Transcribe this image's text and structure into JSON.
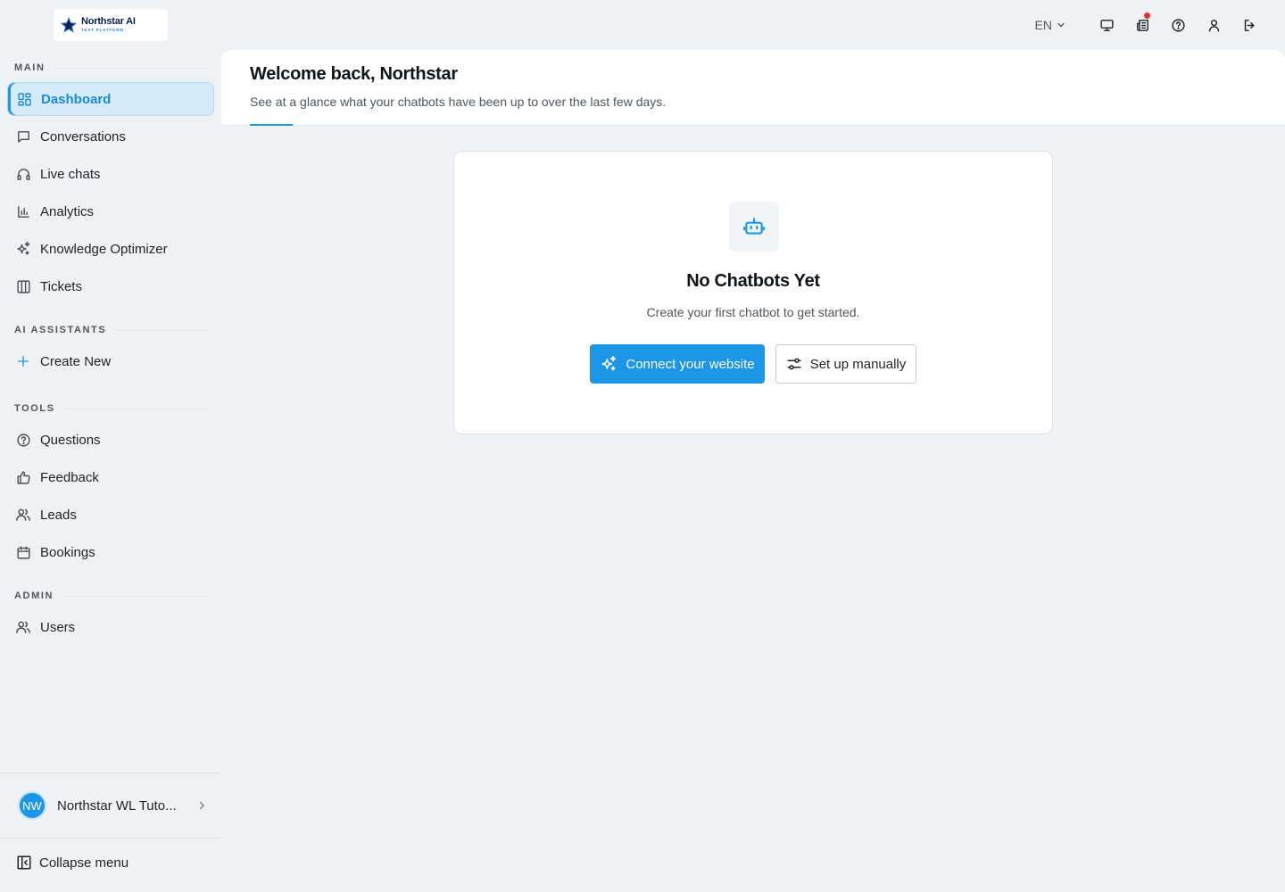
{
  "logo": {
    "name": "Northstar AI",
    "tagline": "TEST PLATFORM"
  },
  "topbar": {
    "language": "EN",
    "icons": [
      "monitor-icon",
      "news-icon",
      "help-icon",
      "user-icon",
      "logout-icon"
    ],
    "notification_color": "#e5302f"
  },
  "sidebar": {
    "sections": {
      "main": "MAIN",
      "ai_assistants": "AI ASSISTANTS",
      "tools": "TOOLS",
      "admin": "ADMIN"
    },
    "main_items": [
      {
        "label": "Dashboard",
        "icon": "dashboard-icon",
        "active": true
      },
      {
        "label": "Conversations",
        "icon": "chat-icon"
      },
      {
        "label": "Live chats",
        "icon": "headset-icon"
      },
      {
        "label": "Analytics",
        "icon": "bar-chart-icon"
      },
      {
        "label": "Knowledge Optimizer",
        "icon": "sparkles-icon"
      },
      {
        "label": "Tickets",
        "icon": "columns-icon"
      }
    ],
    "ai_items": [
      {
        "label": "Create New",
        "icon": "plus-icon"
      }
    ],
    "tools_items": [
      {
        "label": "Questions",
        "icon": "question-icon"
      },
      {
        "label": "Feedback",
        "icon": "thumbs-up-icon"
      },
      {
        "label": "Leads",
        "icon": "users-icon"
      },
      {
        "label": "Bookings",
        "icon": "calendar-icon"
      }
    ],
    "admin_items": [
      {
        "label": "Users",
        "icon": "users-icon"
      }
    ],
    "org": {
      "initials": "NW",
      "name": "Northstar WL Tuto..."
    },
    "collapse_label": "Collapse menu"
  },
  "main": {
    "title": "Welcome back, Northstar",
    "subtitle": "See at a glance what your chatbots have been up to over the last few days.",
    "empty_state": {
      "title": "No Chatbots Yet",
      "subtitle": "Create your first chatbot to get started.",
      "primary_button": "Connect your website",
      "secondary_button": "Set up manually"
    }
  },
  "colors": {
    "accent": "#1c97e8",
    "active_bg": "#d6ebf8",
    "page_bg": "#eff2f5"
  }
}
